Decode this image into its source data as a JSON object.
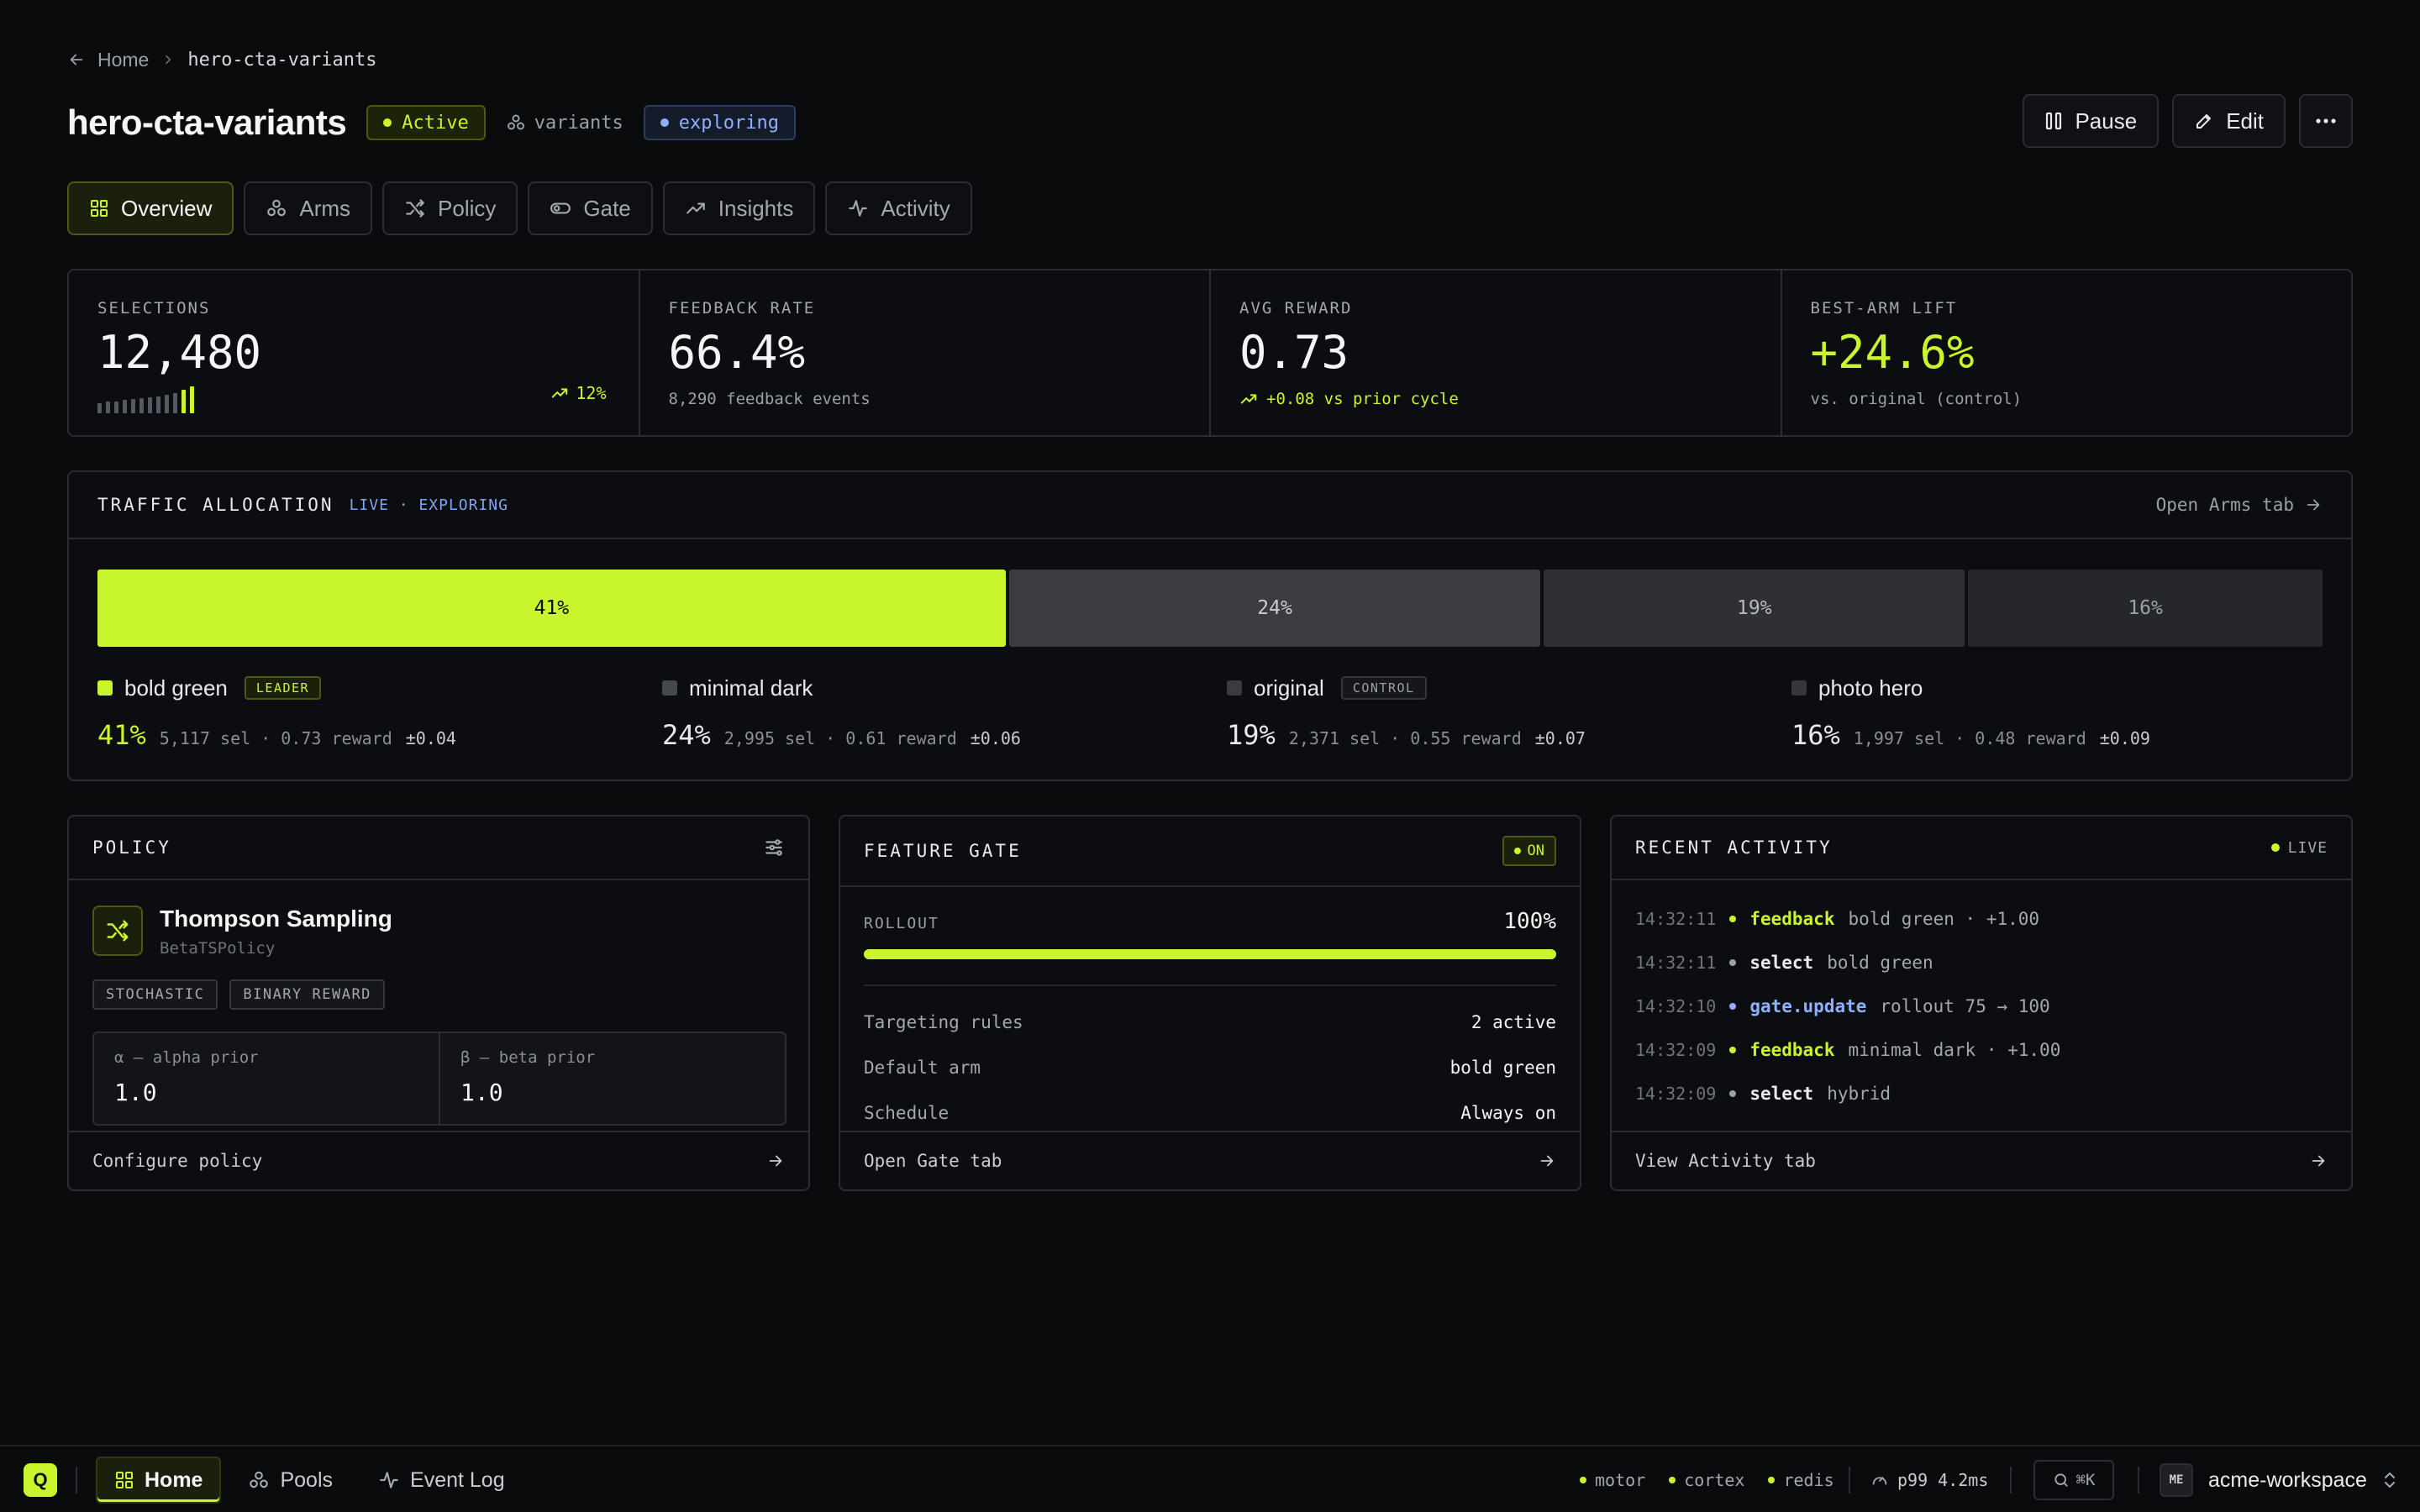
{
  "breadcrumb": {
    "home": "Home",
    "current": "hero-cta-variants"
  },
  "header": {
    "title": "hero-cta-variants",
    "status": "Active",
    "pool": "variants",
    "mode": "exploring"
  },
  "actions": {
    "pause": "Pause",
    "edit": "Edit"
  },
  "tabs": [
    {
      "label": "Overview",
      "icon": "grid-icon",
      "active": true
    },
    {
      "label": "Arms",
      "icon": "arms-icon"
    },
    {
      "label": "Policy",
      "icon": "shuffle-icon"
    },
    {
      "label": "Gate",
      "icon": "toggle-icon"
    },
    {
      "label": "Insights",
      "icon": "trend-icon"
    },
    {
      "label": "Activity",
      "icon": "pulse-icon"
    }
  ],
  "stats": {
    "selections": {
      "label": "SELECTIONS",
      "value": "12,480",
      "trend": "12%"
    },
    "feedback": {
      "label": "FEEDBACK RATE",
      "value": "66.4%",
      "sub": "8,290 feedback events"
    },
    "reward": {
      "label": "AVG REWARD",
      "value": "0.73",
      "sub": "+0.08 vs prior cycle"
    },
    "lift": {
      "label": "BEST-ARM LIFT",
      "value": "+24.6%",
      "sub": "vs. original (control)"
    }
  },
  "traffic": {
    "title": "TRAFFIC ALLOCATION",
    "live": "LIVE · EXPLORING",
    "link": "Open Arms tab",
    "segments": [
      {
        "label": "41%",
        "share": 0.41,
        "bg": "#c8f52b",
        "fg": "#0a0b0d"
      },
      {
        "label": "24%",
        "share": 0.24,
        "bg": "#3a3c41",
        "fg": "#c9ccd1"
      },
      {
        "label": "19%",
        "share": 0.19,
        "bg": "#2e3035",
        "fg": "#b4b8bf"
      },
      {
        "label": "16%",
        "share": 0.16,
        "bg": "#25272b",
        "fg": "#9aa0a8"
      }
    ],
    "arms": [
      {
        "name": "bold green",
        "tag": "LEADER",
        "pct": "41%",
        "meta": "5,117 sel · 0.73 reward",
        "pm": "±0.04",
        "color": "#c8f52b"
      },
      {
        "name": "minimal dark",
        "pct": "24%",
        "meta": "2,995 sel · 0.61 reward",
        "pm": "±0.06",
        "color": "#45484e"
      },
      {
        "name": "original",
        "tag": "CONTROL",
        "pct": "19%",
        "meta": "2,371 sel · 0.55 reward",
        "pm": "±0.07",
        "color": "#3a3c41"
      },
      {
        "name": "photo hero",
        "pct": "16%",
        "meta": "1,997 sel · 0.48 reward",
        "pm": "±0.09",
        "color": "#34363b"
      }
    ]
  },
  "policy": {
    "title": "POLICY",
    "name": "Thompson Sampling",
    "class": "BetaTSPolicy",
    "tags": [
      "STOCHASTIC",
      "BINARY REWARD"
    ],
    "alpha_label": "α — alpha prior",
    "alpha": "1.0",
    "beta_label": "β — beta prior",
    "beta": "1.0",
    "footer": "Configure policy"
  },
  "gate": {
    "title": "FEATURE GATE",
    "state": "ON",
    "rollout_label": "ROLLOUT",
    "rollout": "100%",
    "rollout_fraction": 1.0,
    "rows": [
      {
        "k": "Targeting rules",
        "v": "2 active"
      },
      {
        "k": "Default arm",
        "v": "bold green"
      },
      {
        "k": "Schedule",
        "v": "Always on"
      }
    ],
    "footer": "Open Gate tab"
  },
  "activity": {
    "title": "RECENT ACTIVITY",
    "live": "LIVE",
    "events": [
      {
        "time": "14:32:11",
        "event": "feedback",
        "detail": "bold green · +1.00",
        "color": "#c8f52b"
      },
      {
        "time": "14:32:11",
        "event": "select",
        "detail": "bold green",
        "color": "#e8eaee"
      },
      {
        "time": "14:32:10",
        "event": "gate.update",
        "detail": "rollout 75 → 100",
        "color": "#8fb0ff"
      },
      {
        "time": "14:32:09",
        "event": "feedback",
        "detail": "minimal dark · +1.00",
        "color": "#c8f52b"
      },
      {
        "time": "14:32:09",
        "event": "select",
        "detail": "hybrid",
        "color": "#e8eaee"
      }
    ],
    "footer": "View Activity tab"
  },
  "bottom": {
    "logo": "Q",
    "nav": [
      {
        "label": "Home",
        "active": true
      },
      {
        "label": "Pools"
      },
      {
        "label": "Event Log"
      }
    ],
    "services": [
      "motor",
      "cortex",
      "redis"
    ],
    "p99": "p99 4.2ms",
    "shortcut": "⌘K",
    "avatar": "ME",
    "workspace": "acme-workspace"
  },
  "colors": {
    "accent": "#c8f52b",
    "info": "#8fb0ff",
    "border": "#2a2d33",
    "bg": "#0a0b0d"
  }
}
